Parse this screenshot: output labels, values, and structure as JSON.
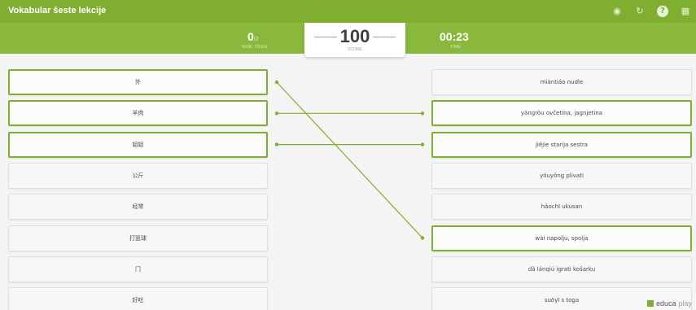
{
  "header": {
    "title": "Vokabular šeste lekcije",
    "num_tries_value": "0",
    "num_tries_total": "/2",
    "num_tries_label": "NUM. TRIES",
    "score_value": "100",
    "score_label": "SCORE",
    "time_value": "00:23",
    "time_label": "TIME",
    "icons": [
      "game-controller-icon",
      "restart-icon",
      "help-icon",
      "grid-icon"
    ]
  },
  "left_items": [
    {
      "label": "外",
      "matched": true
    },
    {
      "label": "羊肉",
      "matched": true
    },
    {
      "label": "姐姐",
      "matched": true
    },
    {
      "label": "公斤",
      "matched": false
    },
    {
      "label": "经常",
      "matched": false
    },
    {
      "label": "打篮球",
      "matched": false
    },
    {
      "label": "门",
      "matched": false
    },
    {
      "label": "好吃",
      "matched": false
    }
  ],
  "right_items": [
    {
      "label": "miàntiáo nudle",
      "matched": false
    },
    {
      "label": "yángròu ovčetina, jagnjetina",
      "matched": true
    },
    {
      "label": "jiějie starija sestra",
      "matched": true
    },
    {
      "label": "yóuyǒng plivati",
      "matched": false
    },
    {
      "label": "hǎochī ukusan",
      "matched": false
    },
    {
      "label": "wài napolju, spolja",
      "matched": true
    },
    {
      "label": "dǎ lánqiú igrati košarku",
      "matched": false
    },
    {
      "label": "suōyī s toga",
      "matched": false
    }
  ],
  "connections": [
    {
      "from": 0,
      "to": 5
    },
    {
      "from": 1,
      "to": 1
    },
    {
      "from": 2,
      "to": 2
    }
  ],
  "colors": {
    "accent": "#7fae30",
    "header": "#8ab83c"
  },
  "branding": {
    "name_part1": "educa",
    "name_part2": "play"
  }
}
